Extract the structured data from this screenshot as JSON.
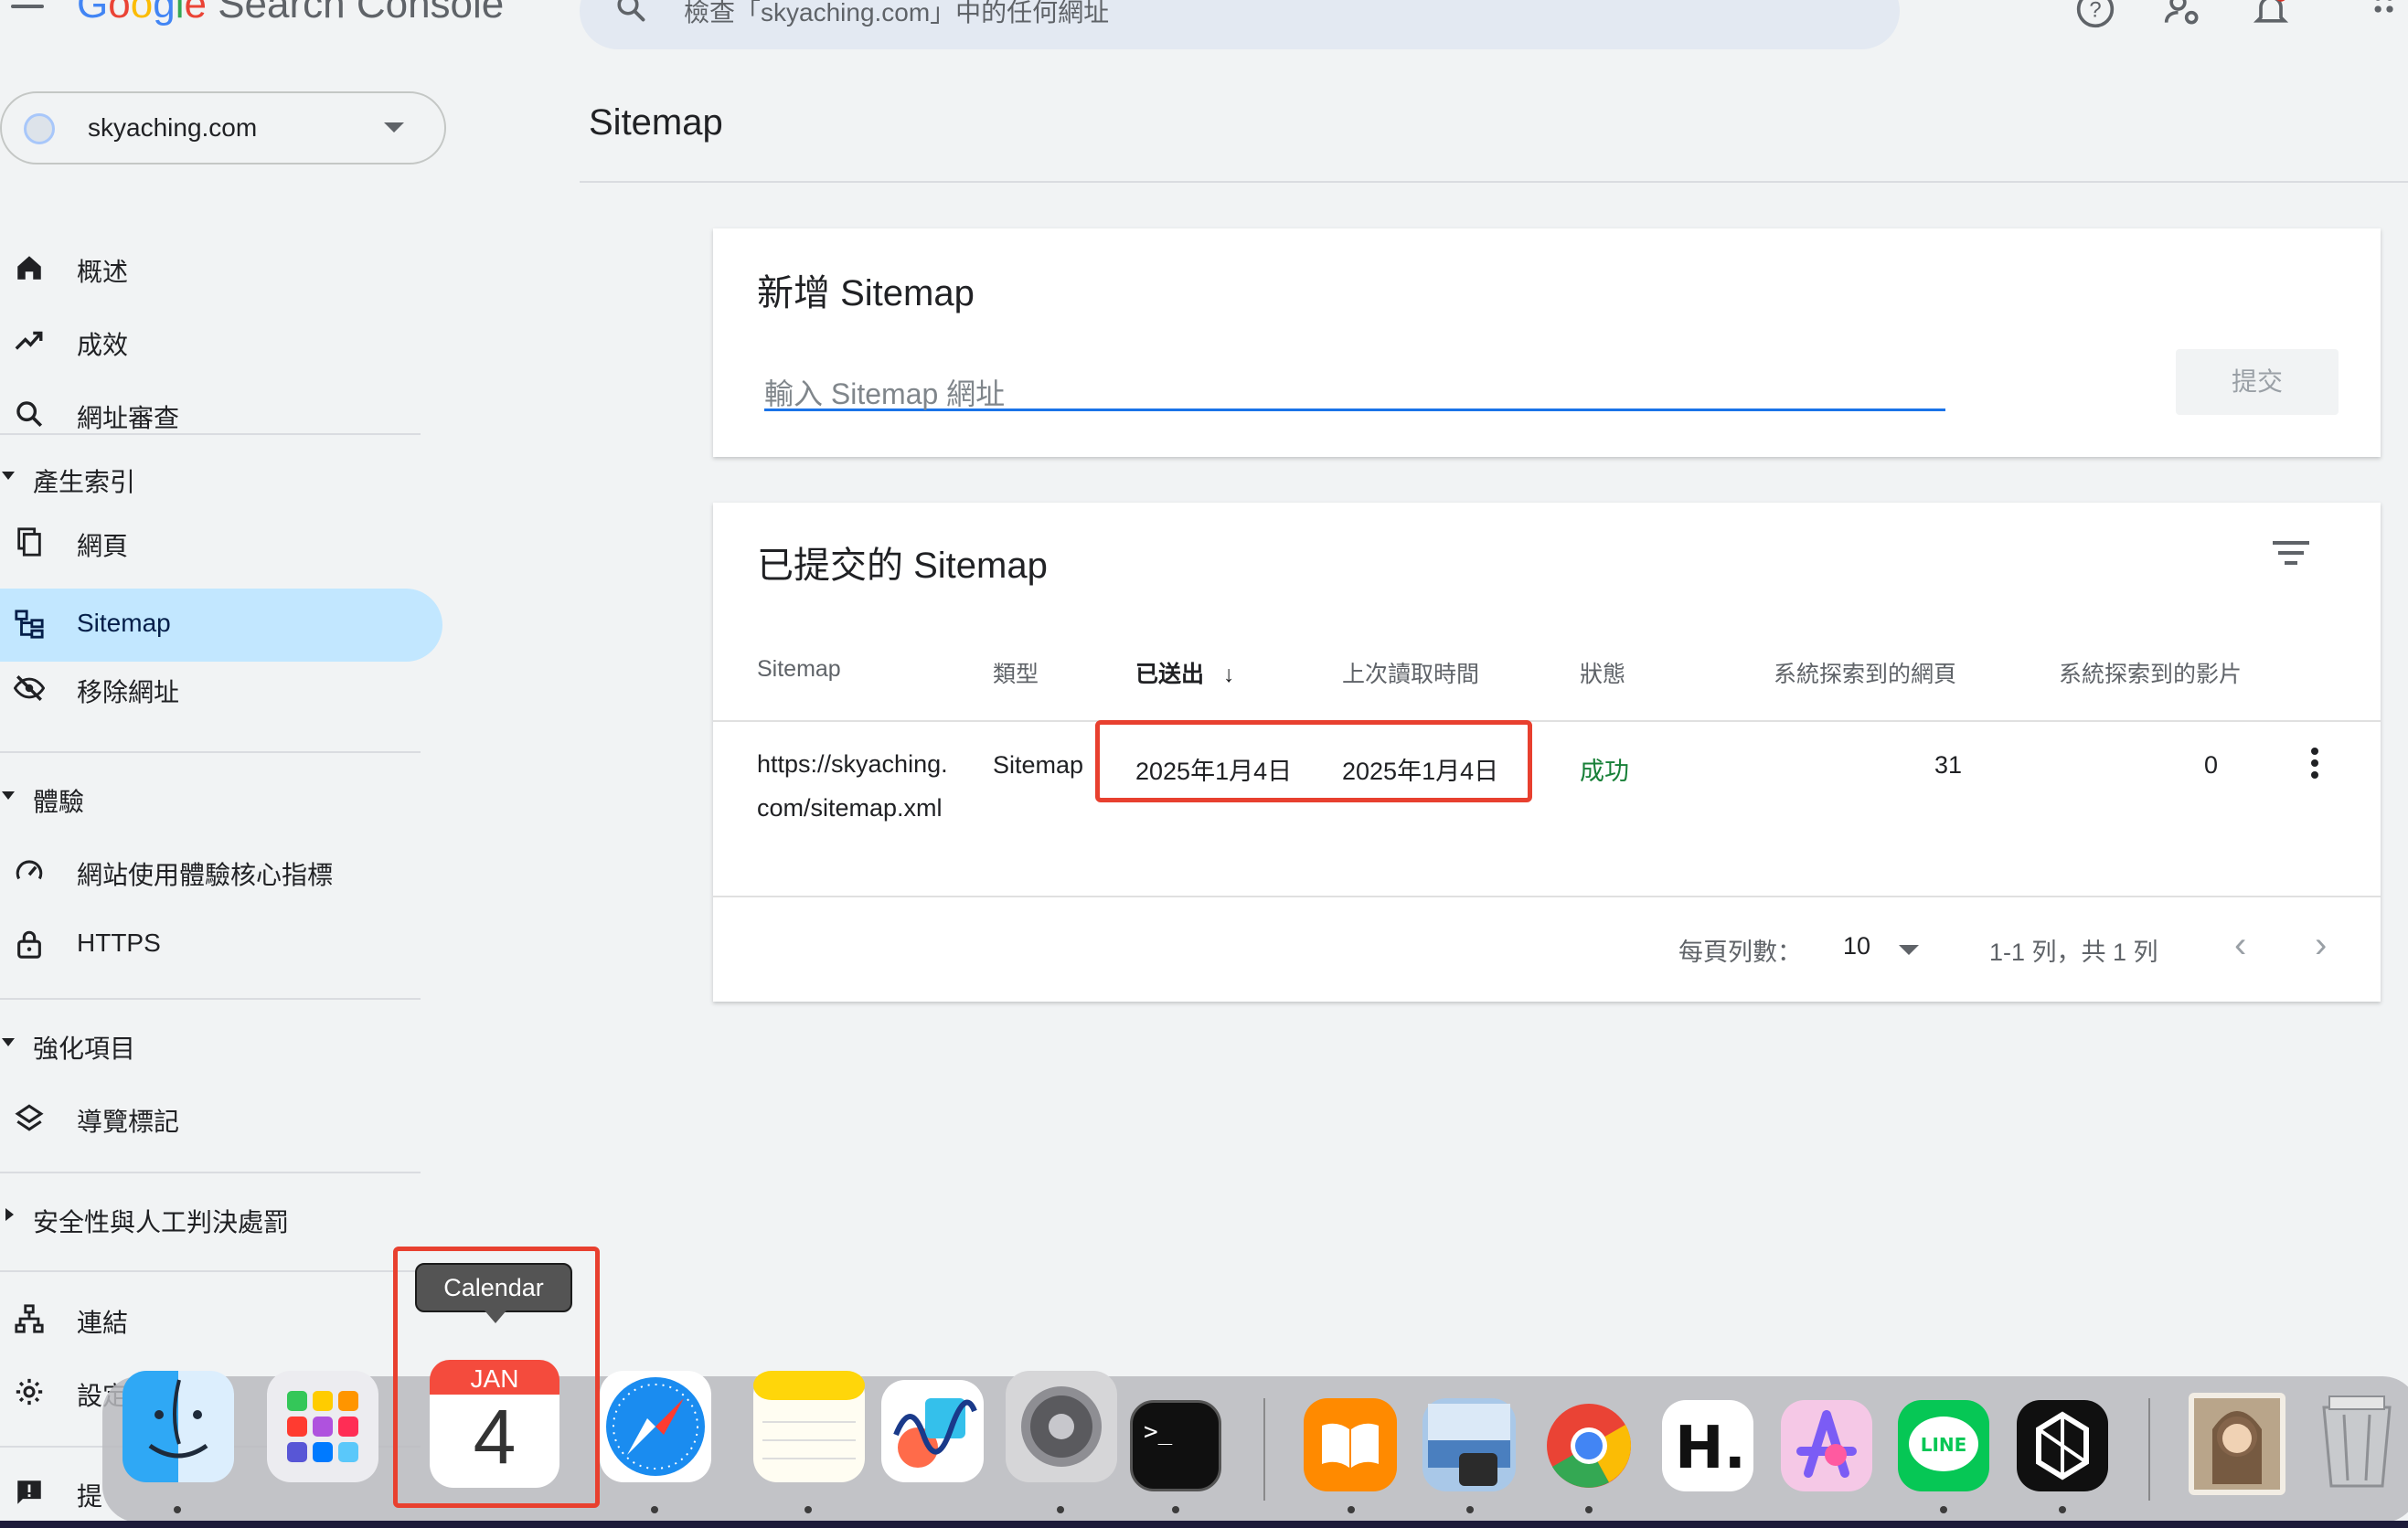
{
  "topbar": {
    "app_name_google": "Google",
    "app_name_rest": "Search Console",
    "search_placeholder": "檢查「skyaching.com」中的任何網址",
    "icons": [
      "menu-icon",
      "search-icon",
      "help-icon",
      "manage-users-icon",
      "notifications-icon",
      "apps-icon"
    ]
  },
  "property": {
    "name": "skyaching.com"
  },
  "sidebar": {
    "items": [
      {
        "label": "概述",
        "icon": "home-icon"
      },
      {
        "label": "成效",
        "icon": "trending-up-icon"
      },
      {
        "label": "網址審查",
        "icon": "search-icon"
      }
    ],
    "sections": [
      {
        "label": "產生索引",
        "items": [
          {
            "label": "網頁",
            "icon": "pages-icon"
          },
          {
            "label": "Sitemap",
            "icon": "sitemap-icon",
            "active": true
          },
          {
            "label": "移除網址",
            "icon": "visibility-off-icon"
          }
        ]
      },
      {
        "label": "體驗",
        "items": [
          {
            "label": "網站使用體驗核心指標",
            "icon": "speed-icon"
          },
          {
            "label": "HTTPS",
            "icon": "lock-icon"
          }
        ]
      },
      {
        "label": "強化項目",
        "items": [
          {
            "label": "導覽標記",
            "icon": "layers-icon"
          }
        ]
      },
      {
        "label": "安全性與人工判決處罰",
        "items": []
      }
    ],
    "bottom_items": [
      {
        "label": "連結",
        "icon": "links-icon"
      },
      {
        "label": "設定",
        "icon": "settings-icon"
      },
      {
        "label": "提",
        "icon": "feedback-icon"
      }
    ]
  },
  "page": {
    "title": "Sitemap"
  },
  "add_sitemap": {
    "title": "新增 Sitemap",
    "input_placeholder": "輸入 Sitemap 網址",
    "submit_label": "提交"
  },
  "submitted": {
    "title": "已提交的 Sitemap",
    "columns": [
      "Sitemap",
      "類型",
      "已送出",
      "上次讀取時間",
      "狀態",
      "系統探索到的網頁",
      "系統探索到的影片"
    ],
    "rows": [
      {
        "sitemap": "https://skyaching.com/sitemap.xml",
        "type": "Sitemap",
        "submitted": "2025年1月4日",
        "last_read": "2025年1月4日",
        "status": "成功",
        "pages": "31",
        "videos": "0"
      }
    ],
    "pager": {
      "rows_per_page_label": "每頁列數：",
      "rows_per_page": "10",
      "range": "1-1 列，共 1 列"
    }
  },
  "dock": {
    "tooltip": "Calendar",
    "calendar_month": "JAN",
    "calendar_day": "4",
    "apps": [
      "finder-icon",
      "launchpad-icon",
      "calendar-icon",
      "safari-icon",
      "notes-icon",
      "freeform-icon",
      "system-settings-icon",
      "terminal-icon",
      "books-icon",
      "preview-icon",
      "chrome-icon",
      "h-app-icon",
      "craft-icon",
      "line-icon",
      "perplexity-icon",
      "photo-icon",
      "trash-icon"
    ]
  },
  "colors": {
    "accent": "#1a73e8",
    "active_nav": "#c2e7ff",
    "success": "#188038",
    "highlight_box": "#e8402f"
  }
}
